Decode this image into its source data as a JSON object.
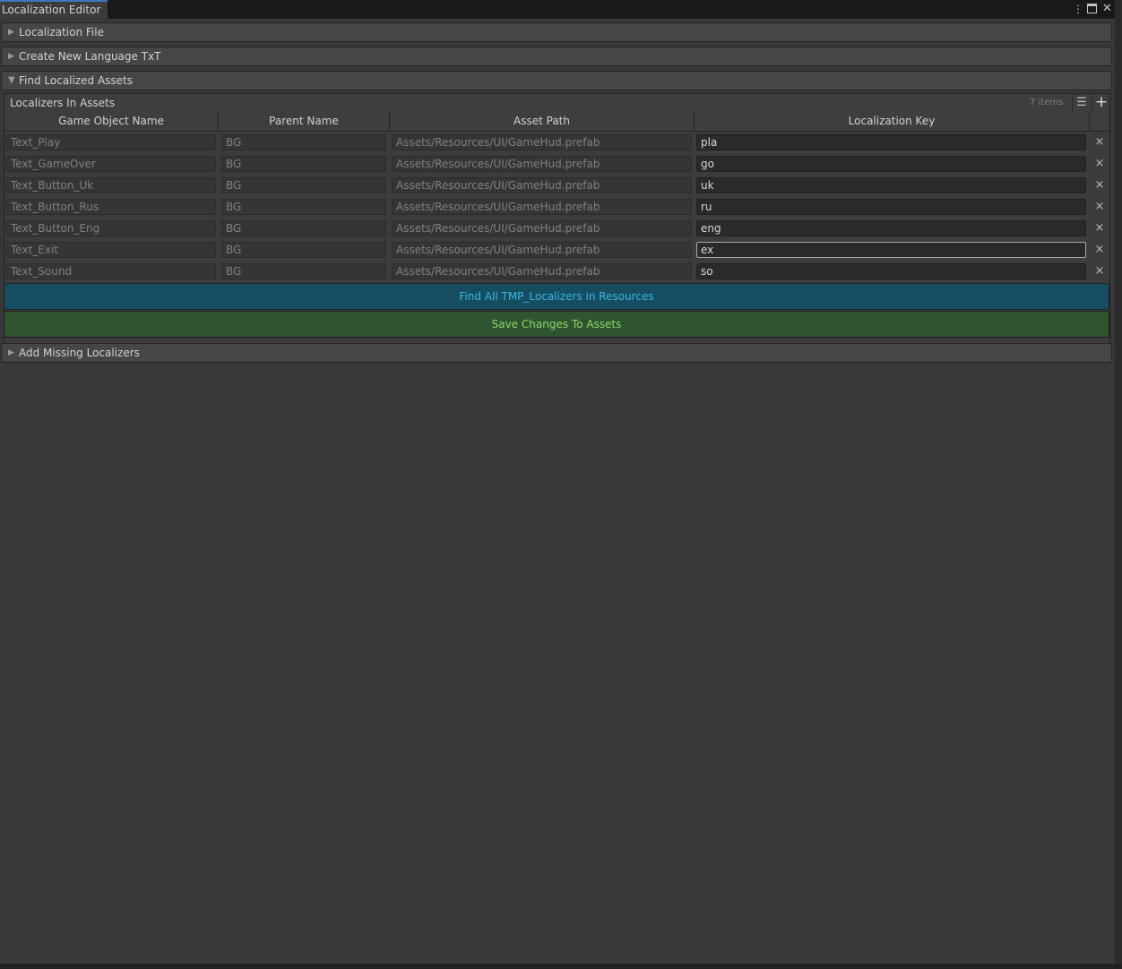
{
  "window": {
    "tab_title": "Localization Editor",
    "menu_icon": "kebab-menu-icon",
    "maximize_icon": "maximize-icon",
    "close_icon": "close-icon"
  },
  "foldouts": {
    "localization_file": {
      "label": "Localization File",
      "expanded": false
    },
    "create_language": {
      "label": "Create New Language TxT",
      "expanded": false
    },
    "find_localized": {
      "label": "Find Localized Assets",
      "expanded": true
    },
    "add_missing": {
      "label": "Add Missing Localizers",
      "expanded": false
    }
  },
  "list": {
    "title": "Localizers In Assets",
    "count_label": "7 items",
    "columns": [
      "Game Object Name",
      "Parent Name",
      "Asset Path",
      "Localization Key"
    ],
    "rows": [
      {
        "name": "Text_Play",
        "parent": "BG",
        "path": "Assets/Resources/UI/GameHud.prefab",
        "key": "pla"
      },
      {
        "name": "Text_GameOver",
        "parent": "BG",
        "path": "Assets/Resources/UI/GameHud.prefab",
        "key": "go"
      },
      {
        "name": "Text_Button_Uk",
        "parent": "BG",
        "path": "Assets/Resources/UI/GameHud.prefab",
        "key": "uk"
      },
      {
        "name": "Text_Button_Rus",
        "parent": "BG",
        "path": "Assets/Resources/UI/GameHud.prefab",
        "key": "ru"
      },
      {
        "name": "Text_Button_Eng",
        "parent": "BG",
        "path": "Assets/Resources/UI/GameHud.prefab",
        "key": "eng"
      },
      {
        "name": "Text_Exit",
        "parent": "BG",
        "path": "Assets/Resources/UI/GameHud.prefab",
        "key": "ex"
      },
      {
        "name": "Text_Sound",
        "parent": "BG",
        "path": "Assets/Resources/UI/GameHud.prefab",
        "key": "so"
      }
    ],
    "remove_glyph": "×"
  },
  "buttons": {
    "find": "Find All TMP_Localizers in Resources",
    "save": "Save Changes To Assets"
  },
  "colors": {
    "find_button_bg": "#174d60",
    "find_button_text": "#34b8e6",
    "save_button_bg": "#2f5530",
    "save_button_text": "#8ed56b",
    "tab_accent": "#3a79bb"
  }
}
